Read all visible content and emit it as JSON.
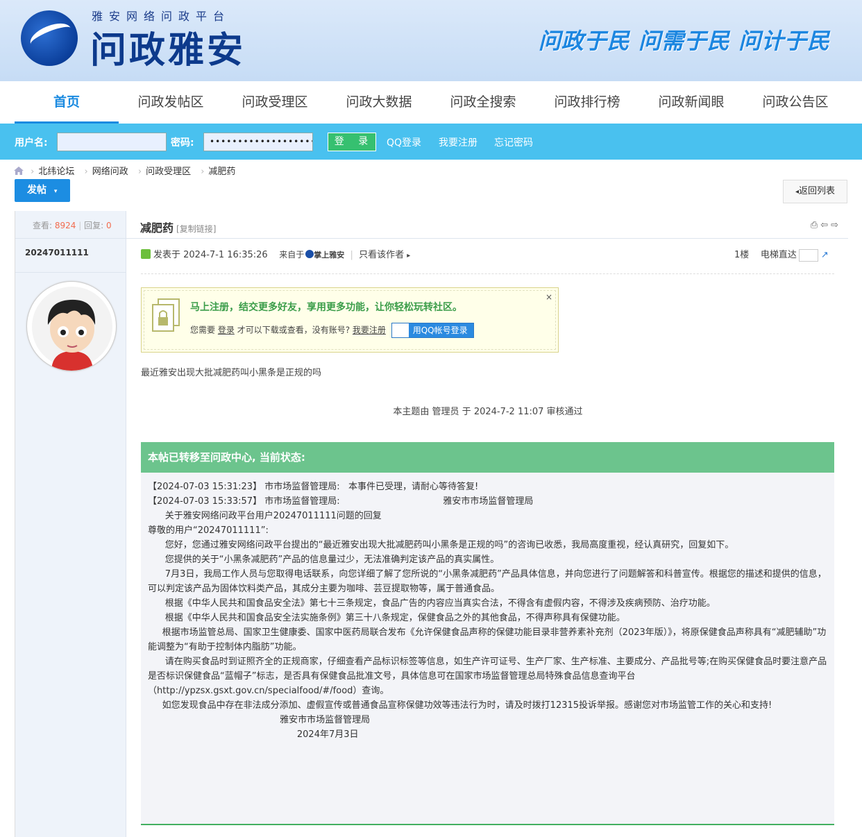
{
  "header": {
    "site_sub": "雅安网络问政平台",
    "site_name": "问政雅安",
    "slogan": "问政于民  问需于民  问计于民"
  },
  "nav": [
    {
      "label": "首页",
      "active": true
    },
    {
      "label": "问政发帖区"
    },
    {
      "label": "问政受理区"
    },
    {
      "label": "问政大数据"
    },
    {
      "label": "问政全搜索"
    },
    {
      "label": "问政排行榜"
    },
    {
      "label": "问政新闻眼"
    },
    {
      "label": "问政公告区"
    }
  ],
  "login": {
    "username_label": "用户名:",
    "username_value": "",
    "password_label": "密码:",
    "password_value": "••••••••••••••••••••••••",
    "login_button": "登 录",
    "qq_login": "QQ登录",
    "register": "我要注册",
    "forgot": "忘记密码"
  },
  "breadcrumb": [
    "北纬论坛",
    "网络问政",
    "问政受理区",
    "减肥药"
  ],
  "post_button": "发帖",
  "back_button": "返回列表",
  "thread": {
    "views_label": "查看:",
    "views": "8924",
    "replies_label": "回复:",
    "replies": "0",
    "title": "减肥药",
    "copy_link": "[复制链接]",
    "author": "20247011111",
    "posted": "发表于 2024-7-1 16:35:26",
    "from_label": "来自于",
    "from_app": "掌上雅安",
    "only_author": "只看该作者",
    "floor": "1楼",
    "elevator": "电梯直达",
    "promo_title": "马上注册，结交更多好友，享用更多功能，让你轻松玩转社区。",
    "promo_text_1": "您需要",
    "promo_login": "登录",
    "promo_text_2": "才可以下载或查看，没有账号?",
    "promo_register": "我要注册",
    "promo_qq": "用QQ帐号登录",
    "content": "最近雅安出现大批减肥药叫小黑条是正规的吗",
    "audit": "本主题由 管理员 于 2024-7-2 11:07 审核通过",
    "status_title": "本帖已转移至问政中心, 当前状态:",
    "status_lines": [
      "【2024-07-03 15:31:23】 市市场监督管理局:   本事件已受理，请耐心等待答复!",
      "",
      "【2024-07-03 15:33:57】 市市场监督管理局:                                    雅安市市场监督管理局",
      "      关于雅安网络问政平台用户20247011111问题的回复",
      "",
      "尊敬的用户“20247011111”:",
      "      您好，您通过雅安网络问政平台提出的“最近雅安出现大批减肥药叫小黑条是正规的吗”的咨询已收悉，我局高度重视，经认真研究，回复如下。",
      "      您提供的关于“小黑条减肥药”产品的信息量过少，无法准确判定该产品的真实属性。",
      "      7月3日，我局工作人员与您取得电话联系，向您详细了解了您所说的“小黑条减肥药”产品具体信息，并向您进行了问题解答和科普宣传。根据您的描述和提供的信息，可以判定该产品为固体饮料类产品，其成分主要为咖啡、芸豆提取物等，属于普通食品。",
      "      根据《中华人民共和国食品安全法》第七十三条规定，食品广告的内容应当真实合法，不得含有虚假内容，不得涉及疾病预防、治疗功能。",
      "      根据《中华人民共和国食品安全法实施条例》第三十八条规定，保健食品之外的其他食品，不得声称具有保健功能。",
      "     根据市场监管总局、国家卫生健康委、国家中医药局联合发布《允许保健食品声称的保健功能目录非营养素补充剂（2023年版）》，将原保健食品声称具有“减肥辅助”功能调整为“有助于控制体内脂肪”功能。",
      "      请在购买食品时到证照齐全的正规商家，仔细查看产品标识标签等信息，如生产许可证号、生产厂家、生产标准、主要成分、产品批号等;在购买保健食品时要注意产品是否标识保健食品“蓝帽子”标志，是否具有保健食品批准文号，具体信息可在国家市场监督管理总局特殊食品信息查询平台（http://ypzsx.gsxt.gov.cn/specialfood/#/food）查询。",
      "     如您发现食品中存在非法成分添加、虚假宣传或普通食品宣称保健功效等违法行为时，请及时拨打12315投诉举报。感谢您对市场监管工作的关心和支持!",
      "",
      "",
      "",
      "                                              雅安市市场监督管理局",
      "                                                    2024年7月3日"
    ]
  }
}
